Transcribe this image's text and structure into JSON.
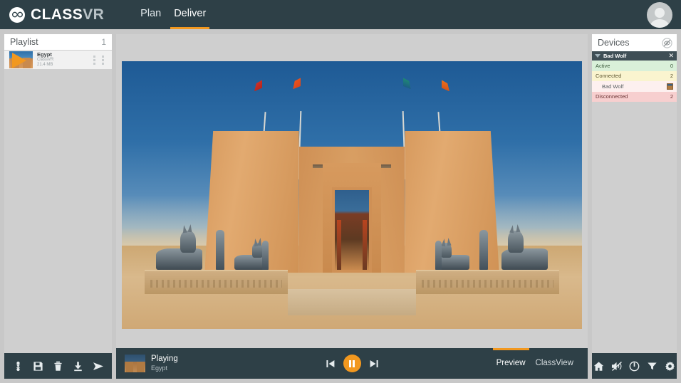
{
  "app": {
    "brand_primary": "CLASS",
    "brand_secondary": "VR",
    "accent_color": "#f2981f",
    "header_color": "#2e4047"
  },
  "nav": {
    "items": [
      {
        "label": "Plan",
        "active": false
      },
      {
        "label": "Deliver",
        "active": true
      }
    ],
    "avatar_icon": "user-avatar-icon"
  },
  "playlist": {
    "title": "Playlist",
    "count": "1",
    "items": [
      {
        "name": "Egypt",
        "source": "ClassVR",
        "size": "21.4 MB",
        "play_icon": "play-icon",
        "handle_icon": "drag-handle-icon"
      }
    ],
    "toolbar": [
      {
        "icon": "assign-user-icon",
        "label": "Assign"
      },
      {
        "icon": "save-icon",
        "label": "Save"
      },
      {
        "icon": "delete-icon",
        "label": "Delete"
      },
      {
        "icon": "download-icon",
        "label": "Download"
      },
      {
        "icon": "send-icon",
        "label": "Send"
      }
    ]
  },
  "stage": {
    "scene_title": "Egypt temple pylon with Anubis statues",
    "playback": {
      "status": "Playing",
      "title": "Egypt",
      "thumbnail_icon": "egypt-thumbnail",
      "previous_icon": "skip-previous-icon",
      "pause_icon": "pause-icon",
      "next_icon": "skip-next-icon"
    },
    "tabs": [
      {
        "label": "Preview",
        "active": true
      },
      {
        "label": "ClassView",
        "active": false
      }
    ]
  },
  "devices": {
    "title": "Devices",
    "hide_icon": "eye-slash-icon",
    "group": {
      "name": "Bad Wolf",
      "caret_icon": "caret-down-icon",
      "close_icon": "close-icon"
    },
    "rows": [
      {
        "label": "Active",
        "value": "0",
        "state": "active"
      },
      {
        "label": "Connected",
        "value": "2",
        "state": "connected"
      },
      {
        "label": "Bad Wolf",
        "value": "",
        "state": "child",
        "chip": true
      },
      {
        "label": "Disconnected",
        "value": "2",
        "state": "disconnected"
      }
    ],
    "toolbar": [
      {
        "icon": "home-icon",
        "label": "Home"
      },
      {
        "icon": "mute-icon",
        "label": "Mute"
      },
      {
        "icon": "power-icon",
        "label": "Power"
      },
      {
        "icon": "filter-icon",
        "label": "Filter"
      },
      {
        "icon": "settings-icon",
        "label": "Settings"
      }
    ]
  }
}
